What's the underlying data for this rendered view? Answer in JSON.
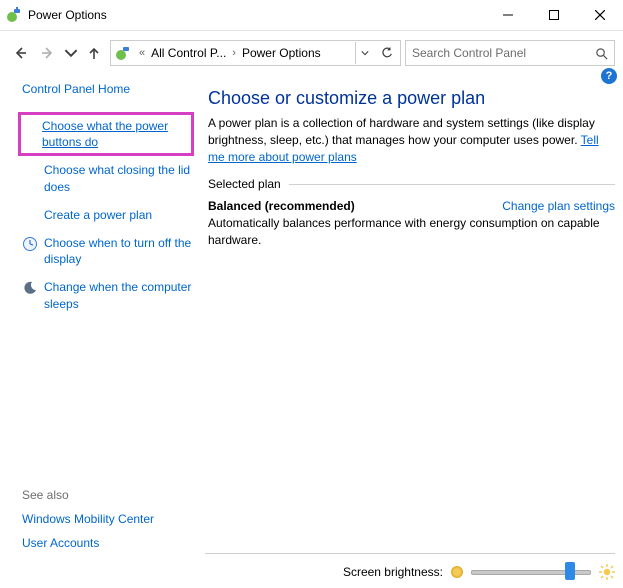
{
  "window": {
    "title": "Power Options"
  },
  "breadcrumb": {
    "root_label": "All Control P...",
    "page_label": "Power Options"
  },
  "search": {
    "placeholder": "Search Control Panel"
  },
  "sidebar": {
    "home": "Control Panel Home",
    "items": [
      {
        "label": "Choose what the power buttons do",
        "icon": "none",
        "highlight": true
      },
      {
        "label": "Choose what closing the lid does",
        "icon": "none"
      },
      {
        "label": "Create a power plan",
        "icon": "none"
      },
      {
        "label": "Choose when to turn off the display",
        "icon": "clock"
      },
      {
        "label": "Change when the computer sleeps",
        "icon": "moon"
      }
    ],
    "see_also_label": "See also",
    "see_also": [
      "Windows Mobility Center",
      "User Accounts"
    ]
  },
  "main": {
    "heading": "Choose or customize a power plan",
    "description_pre": "A power plan is a collection of hardware and system settings (like display brightness, sleep, etc.) that manages how your computer uses power. ",
    "description_link": "Tell me more about power plans",
    "selected_plan_label": "Selected plan",
    "plan": {
      "name": "Balanced (recommended)",
      "action": "Change plan settings",
      "description": "Automatically balances performance with energy consumption on capable hardware."
    }
  },
  "brightness": {
    "label": "Screen brightness:",
    "value_percent": 85
  }
}
